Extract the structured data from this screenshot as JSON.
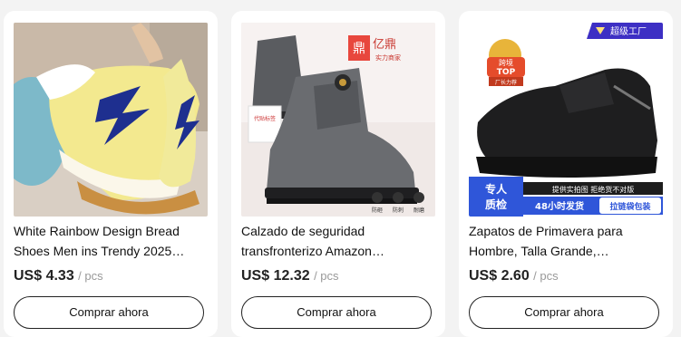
{
  "products": [
    {
      "title": "White Rainbow Design Bread Shoes Men ins Trendy 2025…",
      "price": "US$ 4.33",
      "unit": "/ pcs",
      "button_label": "Comprar ahora"
    },
    {
      "title": "Calzado de seguridad transfronterizo Amazon…",
      "price": "US$ 12.32",
      "unit": "/ pcs",
      "button_label": "Comprar ahora",
      "image_overlay": {
        "brand": "亿鼎",
        "brand_sub": "实力商家",
        "tag": "代贴标签",
        "features": [
          "防砸",
          "防刺",
          "耐磨"
        ]
      }
    },
    {
      "title": "Zapatos de Primavera para Hombre, Talla Grande,…",
      "price": "US$ 2.60",
      "unit": "/ pcs",
      "button_label": "Comprar ahora",
      "image_overlay": {
        "top_badge": "超级工厂",
        "medal_line1": "跨境",
        "medal_line2": "TOP",
        "medal_line3": "厂长力荐",
        "left_block": "专人质检",
        "right_line1": "提供实拍图  拒绝货不对版",
        "right_line2": "48小时发货",
        "right_line3": "拉链袋包装"
      }
    }
  ]
}
